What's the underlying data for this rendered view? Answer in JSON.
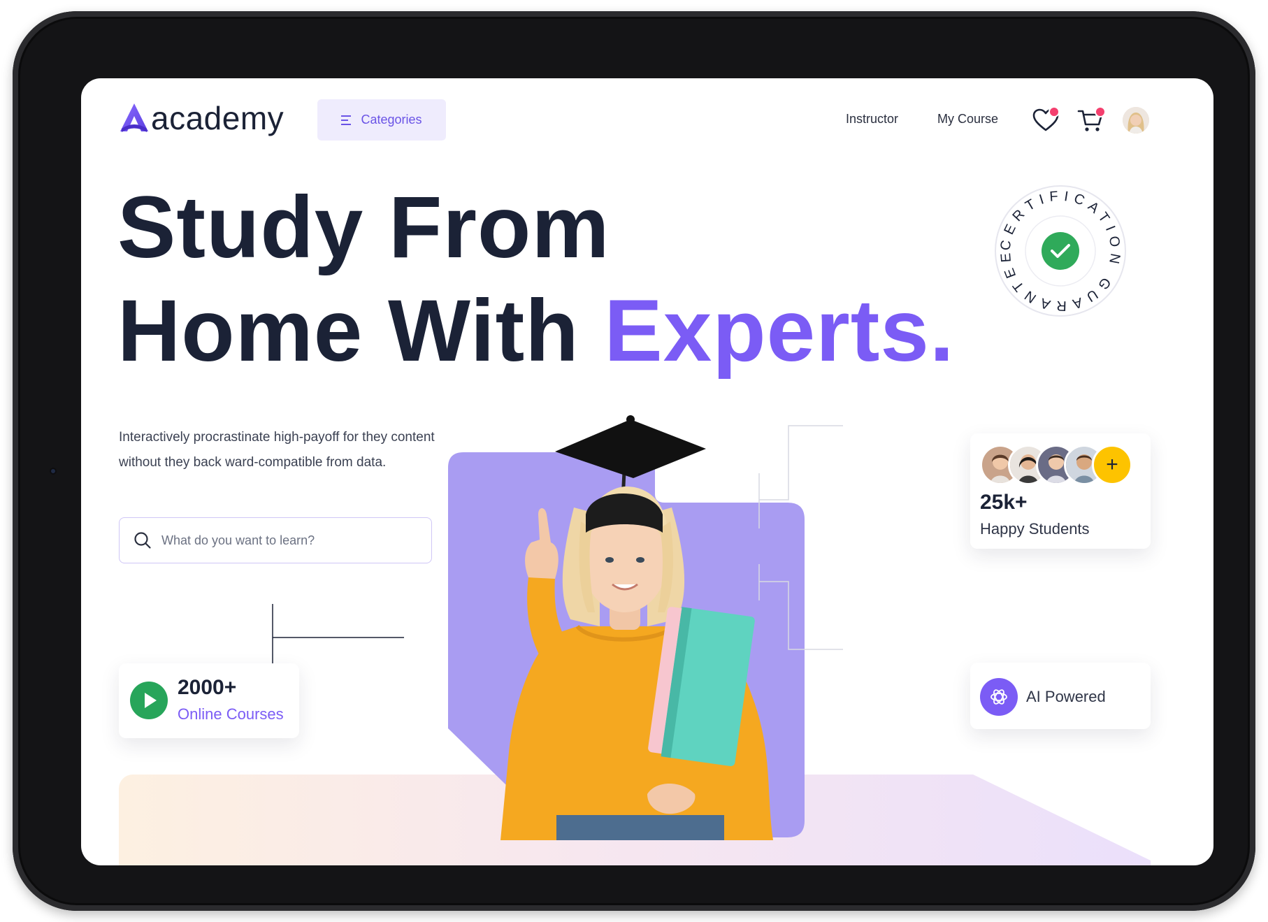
{
  "header": {
    "logo_text": "academy",
    "categories_label": "Categories",
    "nav": [
      "Instructor",
      "My Course"
    ],
    "icons": [
      "heart-icon",
      "cart-icon",
      "user-avatar"
    ]
  },
  "hero": {
    "title_line1": "Study From",
    "title_line2_plain": "Home With ",
    "title_line2_accent": "Experts.",
    "badge_text": "CERTIFICATION GUARANTEE",
    "description": "Interactively procrastinate high-payoff for they content without they  back ward-compatible from data.",
    "search_placeholder": "What do you want to learn?"
  },
  "stats": {
    "courses_value": "2000+",
    "courses_label": "Online Courses",
    "students_value": "25k+",
    "students_label": "Happy Students",
    "ai_label": "AI Powered",
    "plus_symbol": "+"
  },
  "colors": {
    "accent": "#7b5cf5",
    "heading": "#1b2236",
    "green": "#27a55a",
    "yellow": "#fdc300",
    "category_bg": "#efecfd"
  }
}
